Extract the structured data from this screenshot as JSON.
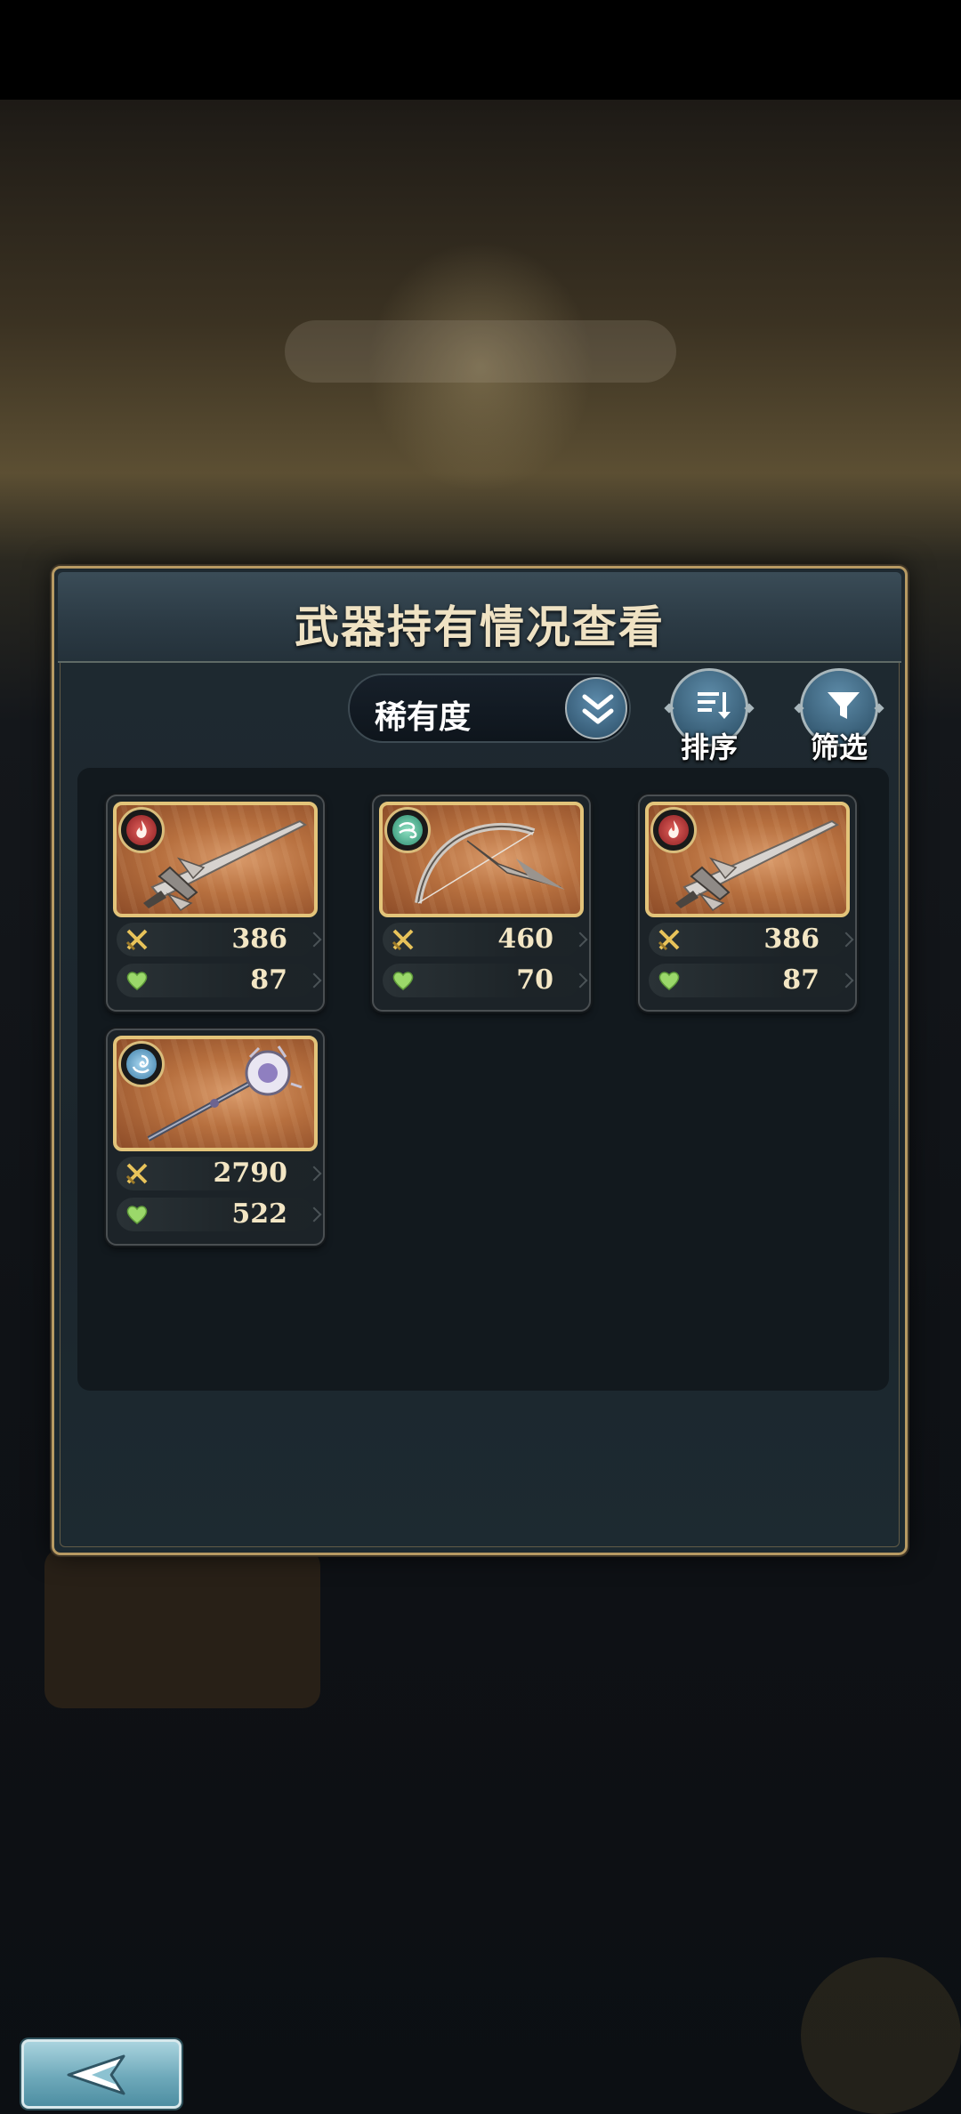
{
  "dialog": {
    "title": "武器持有情况查看",
    "sort_select": {
      "value": "稀有度",
      "icon": "double-chevron-down-icon"
    },
    "sort_button": {
      "label": "排序",
      "icon": "sort-lines-icon"
    },
    "filter_button": {
      "label": "筛选",
      "icon": "funnel-icon"
    }
  },
  "weapons": [
    {
      "element": "fire",
      "weapon": "greatsword",
      "attack": "386",
      "hp": "87"
    },
    {
      "element": "wind",
      "weapon": "bow",
      "attack": "460",
      "hp": "70"
    },
    {
      "element": "fire",
      "weapon": "greatsword",
      "attack": "386",
      "hp": "87"
    },
    {
      "element": "water",
      "weapon": "staff",
      "attack": "2790",
      "hp": "522"
    }
  ],
  "stat_icons": {
    "attack": "crossed-swords-icon",
    "hp": "heart-icon"
  },
  "back_button": {
    "icon": "back-arrow-icon"
  },
  "colors": {
    "accent_gold": "#e3c47a",
    "panel": "#12191e",
    "button_blue": "#5e8ca9"
  }
}
